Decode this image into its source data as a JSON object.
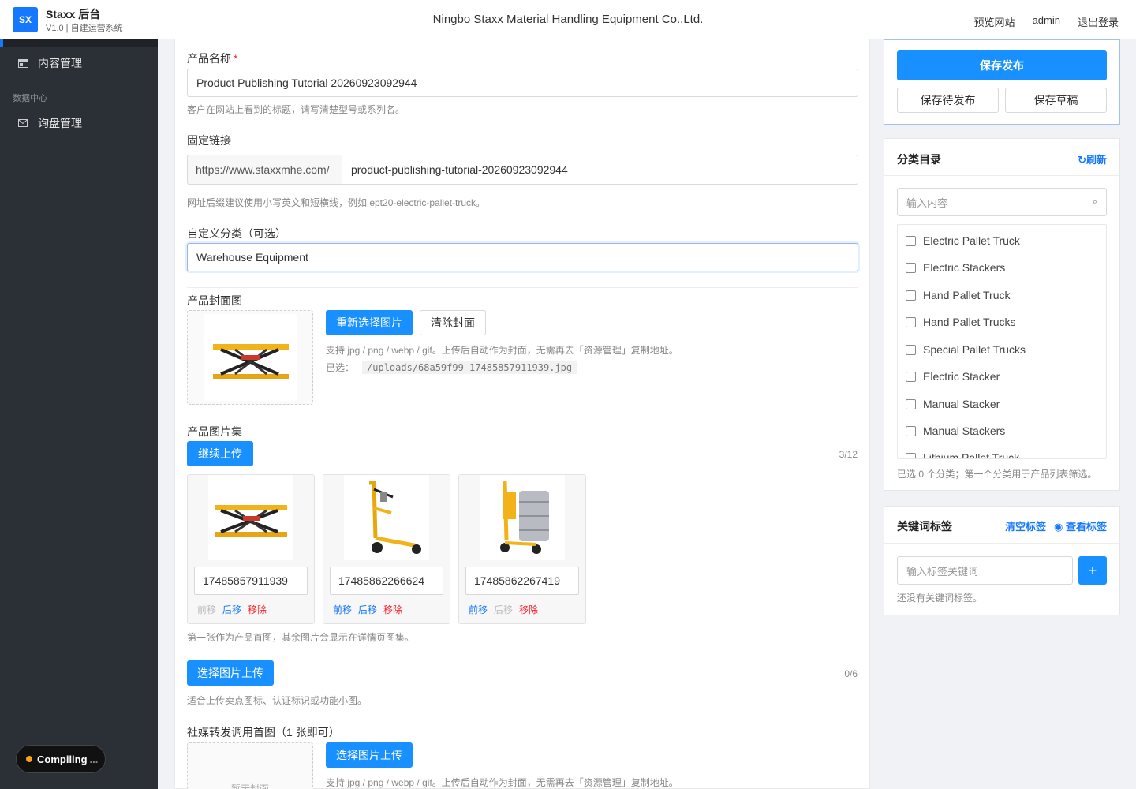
{
  "header": {
    "logo": "SX",
    "brand": "Staxx 后台",
    "subtitle": "V1.0 | 自建运营系统",
    "company": "Ningbo Staxx Material Handling Equipment Co.,Ltd.",
    "links": [
      "预览网站",
      "admin",
      "退出登录"
    ]
  },
  "sidebar": {
    "items": [
      {
        "label": "内容管理",
        "icon": "content-icon"
      },
      {
        "label": "询盘管理",
        "icon": "mail-icon"
      }
    ],
    "group_label": "数据中心",
    "compile_status": "Compiling",
    "compile_ellipsis": "..."
  },
  "form": {
    "name_label": "产品名称",
    "name_required": "*",
    "name_value": "Product Publishing Tutorial 20260923092944",
    "name_help": "客户在网站上看到的标题，请写清楚型号或系列名。",
    "slug_label": "固定链接",
    "slug_prefix": "https://www.staxxmhe.com/",
    "slug_value": "product-publishing-tutorial-20260923092944",
    "slug_help": "网址后缀建议使用小写英文和短横线，例如 ept20-electric-pallet-truck。",
    "custom_cat_label": "自定义分类（可选）",
    "custom_cat_value": "Warehouse Equipment",
    "cover_label": "产品封面图",
    "cover_reselect": "重新选择图片",
    "cover_clear": "清除封面",
    "cover_help": "支持 jpg / png / webp / gif。上传后自动作为封面，无需再去「资源管理」复制地址。",
    "cover_selected_label": "已选：",
    "cover_selected_path": "/uploads/68a59f99-17485857911939.jpg",
    "gallery_label": "产品图片集",
    "gallery_upload": "继续上传",
    "gallery_count": "3/12",
    "gallery_items": [
      {
        "name": "17485857911939",
        "prev": "前移",
        "next": "后移",
        "remove": "移除",
        "image": "scissor-lift-image"
      },
      {
        "name": "17485862266624",
        "prev": "前移",
        "next": "后移",
        "remove": "移除",
        "image": "drum-truck-image"
      },
      {
        "name": "17485862267419",
        "prev": "前移",
        "next": "后移",
        "remove": "移除",
        "image": "drum-lifter-image"
      }
    ],
    "gallery_help": "第一张作为产品首图，其余图片会显示在详情页图集。",
    "icons_upload": "选择图片上传",
    "icons_count": "0/6",
    "icons_help": "适合上传卖点图标、认证标识或功能小图。",
    "social_label": "社媒转发调用首图（1 张即可）",
    "social_upload": "选择图片上传",
    "social_placeholder": "暂无封面",
    "social_help": "支持 jpg / png / webp / gif。上传后自动作为封面，无需再去「资源管理」复制地址。"
  },
  "publish": {
    "publish": "保存发布",
    "pending": "保存待发布",
    "draft": "保存草稿"
  },
  "categories": {
    "title": "分类目录",
    "refresh": "↻刷新",
    "search_placeholder": "输入内容",
    "items": [
      "Electric Pallet Truck",
      "Electric Stackers",
      "Hand Pallet Truck",
      "Hand Pallet Trucks",
      "Special Pallet Trucks",
      "Electric Stacker",
      "Manual Stacker",
      "Manual Stackers",
      "Lithium Pallet Truck"
    ],
    "summary": "已选 0 个分类；第一个分类用于产品列表筛选。"
  },
  "keywords": {
    "title": "关键词标签",
    "clear": "清空标签",
    "view": "◉ 查看标签",
    "input_placeholder": "输入标签关键词",
    "add": "+",
    "empty": "还没有关键词标签。"
  },
  "colors": {
    "primary": "#1890ff",
    "sidebar": "#2b2f36",
    "danger": "#f5222d"
  }
}
